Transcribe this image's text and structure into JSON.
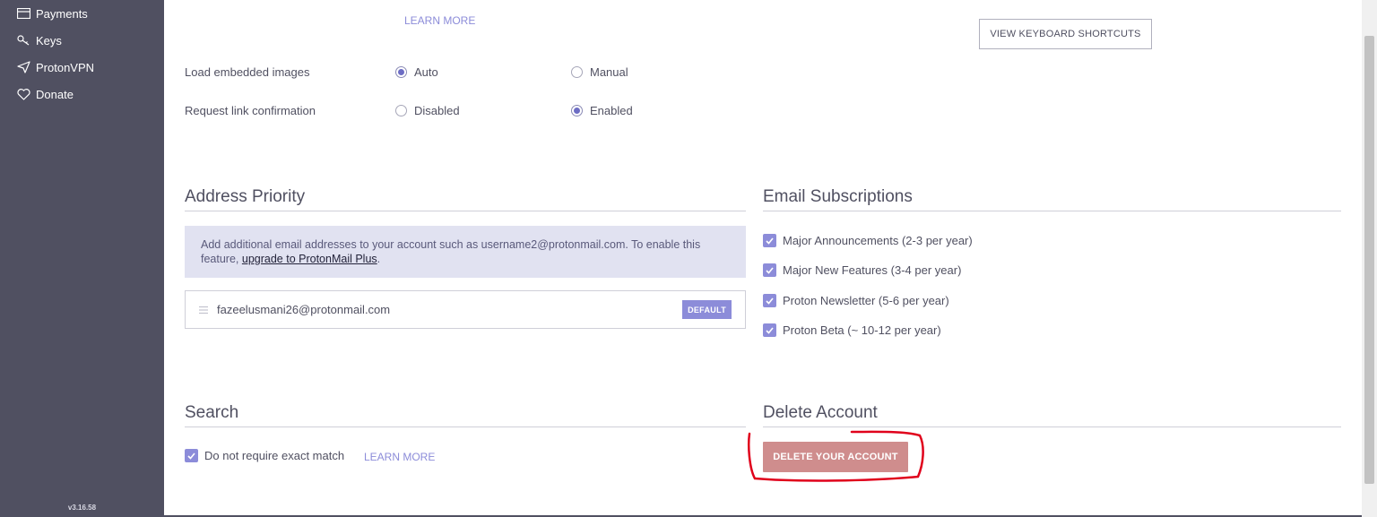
{
  "sidebar": {
    "items": [
      {
        "label": "Payments",
        "icon": "credit-card-icon"
      },
      {
        "label": "Keys",
        "icon": "key-icon"
      },
      {
        "label": "ProtonVPN",
        "icon": "vpn-arrow-icon"
      },
      {
        "label": "Donate",
        "icon": "heart-icon"
      }
    ],
    "version": "v3.16.58"
  },
  "shortcuts": {
    "learn_more": "LEARN MORE",
    "view_button": "VIEW KEYBOARD SHORTCUTS"
  },
  "embedded_images": {
    "label": "Load embedded images",
    "options": [
      {
        "label": "Auto",
        "selected": true
      },
      {
        "label": "Manual",
        "selected": false
      }
    ]
  },
  "link_confirmation": {
    "label": "Request link confirmation",
    "options": [
      {
        "label": "Disabled",
        "selected": false
      },
      {
        "label": "Enabled",
        "selected": true
      }
    ]
  },
  "address_priority": {
    "title": "Address Priority",
    "info_text": "Add additional email addresses to your account such as username2@protonmail.com. To enable this feature, ",
    "info_link": "upgrade to ProtonMail Plus",
    "info_suffix": ".",
    "address": "fazeelusmani26@protonmail.com",
    "badge": "DEFAULT"
  },
  "email_subscriptions": {
    "title": "Email Subscriptions",
    "items": [
      {
        "label": "Major Announcements (2-3 per year)",
        "checked": true
      },
      {
        "label": "Major New Features (3-4 per year)",
        "checked": true
      },
      {
        "label": "Proton Newsletter (5-6 per year)",
        "checked": true
      },
      {
        "label": "Proton Beta (~ 10-12 per year)",
        "checked": true
      }
    ]
  },
  "search": {
    "title": "Search",
    "checkbox_label": "Do not require exact match",
    "checked": true,
    "learn_more": "LEARN MORE"
  },
  "delete_account": {
    "title": "Delete Account",
    "button": "DELETE YOUR ACCOUNT"
  },
  "colors": {
    "sidebar": "#505061",
    "accent": "#8c8cd9",
    "danger": "#cf8d8d",
    "annotation": "#e0001b"
  }
}
